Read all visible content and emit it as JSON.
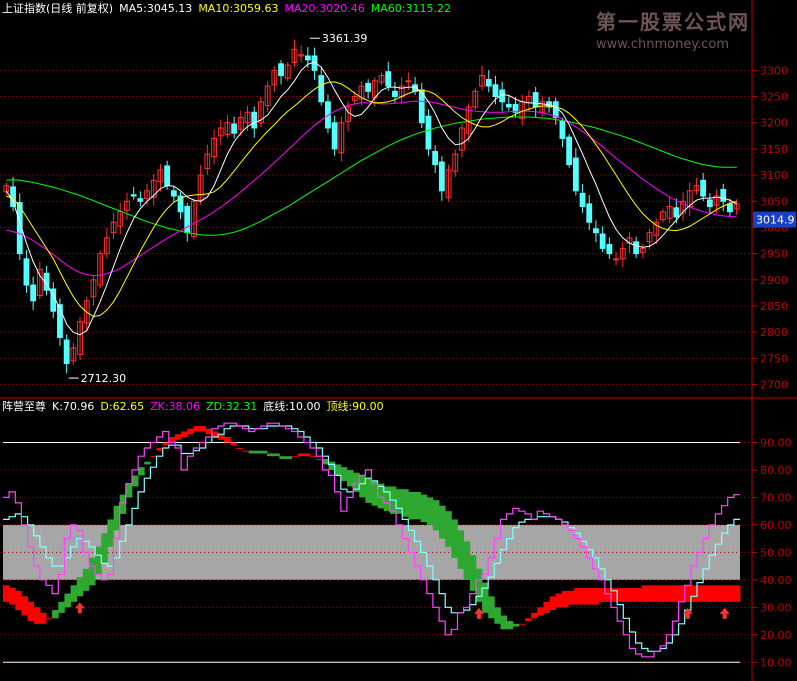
{
  "colors": {
    "background": "#000000",
    "up": "#ff3030",
    "down": "#54ffff",
    "ma5": "#ffffff",
    "ma10": "#ffff00",
    "ma20": "#ff00ff",
    "ma60": "#00ff00",
    "grid": "#8b0000",
    "axis": "#c00000",
    "axis_label": "#c00000",
    "indicator_red": "#ff0000",
    "indicator_green": "#2ea830",
    "band": "#a6a6a6",
    "k_line": "#ff44ff",
    "d_line": "#88ffff",
    "arrow": "#ff3030",
    "watermark": "#c79a9a"
  },
  "header": {
    "main_title": "上证指数(日线 前复权)",
    "ma5": "MA5:3045.13",
    "ma10": "MA10:3059.63",
    "ma20": "MA20:3020.46",
    "ma60": "MA60:3115.22"
  },
  "indicator_header": {
    "title": "阵营至尊",
    "k": "K:70.96",
    "d": "D:62.65",
    "zk": "ZK:38.06",
    "zd": "ZD:32.31",
    "bottom": "底线:10.00",
    "top": "顶线:90.00"
  },
  "watermark": {
    "line1": "第一股票公式网",
    "line2": "www.chnmoney.com"
  },
  "chart_data": [
    {
      "type": "candlestick",
      "title": "上证指数(日线 前复权)",
      "ylim": [
        2680,
        3400
      ],
      "y_ticks": [
        2700,
        2750,
        2800,
        2850,
        2900,
        2950,
        3000,
        3050,
        3100,
        3150,
        3200,
        3250,
        3300
      ],
      "last_price_label": "3014.9",
      "last_price": 3014.9,
      "annotations": [
        {
          "text": "3361.39",
          "value": 3361.39,
          "index": 45
        },
        {
          "text": "2712.30",
          "value": 2712.3,
          "index": 9
        }
      ],
      "closes": [
        3080,
        3040,
        2950,
        2890,
        2860,
        2920,
        2880,
        2840,
        2790,
        2740,
        2770,
        2820,
        2860,
        2900,
        2950,
        2980,
        3010,
        3030,
        3050,
        3060,
        3050,
        3070,
        3090,
        3110,
        3080,
        3060,
        3030,
        2990,
        3050,
        3100,
        3140,
        3170,
        3190,
        3200,
        3180,
        3210,
        3220,
        3190,
        3240,
        3270,
        3300,
        3290,
        3310,
        3340,
        3330,
        3320,
        3300,
        3240,
        3190,
        3150,
        3200,
        3230,
        3250,
        3270,
        3260,
        3280,
        3290,
        3270,
        3250,
        3270,
        3280,
        3260,
        3200,
        3150,
        3120,
        3070,
        3110,
        3140,
        3190,
        3230,
        3260,
        3290,
        3270,
        3250,
        3240,
        3230,
        3220,
        3240,
        3250,
        3230,
        3240,
        3230,
        3210,
        3170,
        3120,
        3070,
        3040,
        3010,
        2990,
        2960,
        2950,
        2940,
        2960,
        2980,
        2950,
        2960,
        2990,
        3010,
        3030,
        3040,
        3020,
        3050,
        3070,
        3080,
        3060,
        3040,
        3060,
        3050,
        3030,
        3045
      ],
      "ma5": [
        3070,
        3050,
        3010,
        2970,
        2935,
        2908,
        2892,
        2870,
        2845,
        2815,
        2800,
        2795,
        2803,
        2830,
        2858,
        2890,
        2925,
        2960,
        2990,
        3017,
        3036,
        3050,
        3061,
        3074,
        3080,
        3079,
        3070,
        3058,
        3052,
        3050,
        3058,
        3080,
        3110,
        3140,
        3164,
        3180,
        3193,
        3200,
        3205,
        3215,
        3232,
        3250,
        3263,
        3280,
        3300,
        3312,
        3316,
        3306,
        3286,
        3262,
        3240,
        3220,
        3212,
        3216,
        3230,
        3248,
        3262,
        3268,
        3268,
        3266,
        3268,
        3268,
        3258,
        3240,
        3218,
        3190,
        3170,
        3158,
        3160,
        3170,
        3190,
        3212,
        3230,
        3245,
        3254,
        3252,
        3245,
        3240,
        3238,
        3237,
        3236,
        3234,
        3230,
        3218,
        3196,
        3168,
        3140,
        3110,
        3082,
        3050,
        3020,
        2996,
        2980,
        2970,
        2965,
        2962,
        2964,
        2972,
        2985,
        3000,
        3014,
        3030,
        3042,
        3052,
        3056,
        3056,
        3058,
        3056,
        3052,
        3045
      ],
      "ma10": [
        3060,
        3055,
        3040,
        3020,
        3000,
        2980,
        2960,
        2940,
        2915,
        2890,
        2868,
        2850,
        2838,
        2830,
        2832,
        2842,
        2858,
        2880,
        2905,
        2930,
        2955,
        2978,
        3000,
        3020,
        3036,
        3048,
        3056,
        3060,
        3062,
        3063,
        3064,
        3068,
        3078,
        3092,
        3108,
        3124,
        3140,
        3156,
        3170,
        3184,
        3196,
        3210,
        3222,
        3232,
        3243,
        3254,
        3264,
        3272,
        3277,
        3278,
        3274,
        3266,
        3256,
        3248,
        3242,
        3238,
        3238,
        3240,
        3244,
        3250,
        3256,
        3260,
        3262,
        3260,
        3254,
        3244,
        3232,
        3220,
        3210,
        3202,
        3196,
        3192,
        3192,
        3196,
        3202,
        3210,
        3216,
        3222,
        3226,
        3230,
        3232,
        3232,
        3230,
        3226,
        3218,
        3206,
        3192,
        3176,
        3158,
        3140,
        3120,
        3100,
        3080,
        3060,
        3042,
        3026,
        3014,
        3004,
        2998,
        2995,
        2994,
        2997,
        3002,
        3010,
        3018,
        3026,
        3034,
        3041,
        3046,
        3050
      ],
      "ma20": [
        2995,
        2992,
        2988,
        2982,
        2975,
        2966,
        2958,
        2948,
        2938,
        2928,
        2920,
        2914,
        2910,
        2908,
        2909,
        2912,
        2916,
        2922,
        2930,
        2938,
        2946,
        2955,
        2963,
        2971,
        2979,
        2987,
        2994,
        3001,
        3008,
        3015,
        3022,
        3030,
        3039,
        3048,
        3058,
        3068,
        3079,
        3090,
        3101,
        3112,
        3124,
        3136,
        3148,
        3160,
        3172,
        3184,
        3195,
        3205,
        3214,
        3222,
        3228,
        3233,
        3236,
        3238,
        3238,
        3237,
        3236,
        3236,
        3237,
        3238,
        3240,
        3241,
        3241,
        3240,
        3238,
        3235,
        3232,
        3229,
        3226,
        3224,
        3222,
        3221,
        3220,
        3220,
        3220,
        3221,
        3222,
        3222,
        3222,
        3221,
        3219,
        3216,
        3212,
        3207,
        3200,
        3192,
        3183,
        3174,
        3164,
        3154,
        3143,
        3132,
        3122,
        3112,
        3102,
        3092,
        3083,
        3074,
        3066,
        3058,
        3051,
        3045,
        3039,
        3034,
        3030,
        3027,
        3024,
        3022,
        3021,
        3020
      ],
      "ma60": [
        3090,
        3091,
        3090,
        3088,
        3086,
        3083,
        3080,
        3077,
        3073,
        3069,
        3065,
        3061,
        3056,
        3051,
        3046,
        3041,
        3036,
        3031,
        3026,
        3021,
        3016,
        3011,
        3007,
        3003,
        2999,
        2996,
        2993,
        2990,
        2988,
        2986,
        2985,
        2985,
        2986,
        2988,
        2991,
        2995,
        3000,
        3006,
        3012,
        3019,
        3026,
        3033,
        3040,
        3048,
        3056,
        3064,
        3072,
        3080,
        3088,
        3096,
        3104,
        3112,
        3120,
        3128,
        3135,
        3142,
        3149,
        3156,
        3162,
        3168,
        3173,
        3178,
        3182,
        3186,
        3190,
        3193,
        3196,
        3199,
        3201,
        3203,
        3205,
        3207,
        3208,
        3209,
        3210,
        3211,
        3211,
        3211,
        3211,
        3210,
        3209,
        3208,
        3206,
        3204,
        3202,
        3199,
        3196,
        3193,
        3190,
        3186,
        3182,
        3178,
        3174,
        3170,
        3165,
        3160,
        3155,
        3150,
        3145,
        3140,
        3135,
        3131,
        3127,
        3123,
        3120,
        3118,
        3116,
        3115,
        3115,
        3115
      ]
    },
    {
      "type": "area",
      "title": "阵营至尊",
      "ylim": [
        5,
        100
      ],
      "y_ticks": [
        10,
        20,
        30,
        40,
        50,
        60,
        70,
        80,
        90
      ],
      "band": [
        40,
        60
      ],
      "hlines": [
        10,
        90
      ],
      "arrow_indices": [
        17,
        113,
        162,
        170
      ],
      "k": [
        70,
        72,
        68,
        60,
        52,
        45,
        40,
        38,
        35,
        42,
        55,
        60,
        58,
        50,
        45,
        42,
        40,
        42,
        55,
        68,
        75,
        80,
        85,
        88,
        90,
        92,
        94,
        90,
        88,
        80,
        85,
        88,
        90,
        92,
        95,
        96,
        97,
        97,
        96,
        95,
        94,
        95,
        96,
        97,
        97,
        96,
        95,
        94,
        92,
        90,
        88,
        85,
        80,
        78,
        72,
        65,
        70,
        75,
        78,
        80,
        75,
        70,
        68,
        65,
        60,
        55,
        50,
        45,
        40,
        35,
        30,
        25,
        20,
        22,
        28,
        30,
        35,
        40,
        42,
        48,
        55,
        62,
        64,
        66,
        65,
        64,
        62,
        65,
        64,
        63,
        62,
        60,
        58,
        55,
        52,
        48,
        44,
        40,
        35,
        30,
        25,
        20,
        15,
        13,
        12,
        12,
        14,
        16,
        20,
        25,
        32,
        38,
        45,
        50,
        55,
        60,
        64,
        67,
        70,
        71
      ],
      "d": [
        62,
        63,
        64,
        63,
        60,
        56,
        52,
        48,
        45,
        45,
        48,
        52,
        55,
        54,
        52,
        49,
        46,
        45,
        48,
        54,
        60,
        66,
        72,
        77,
        81,
        85,
        88,
        89,
        89,
        86,
        86,
        87,
        88,
        90,
        92,
        93,
        95,
        96,
        96,
        96,
        95,
        95,
        95,
        96,
        96,
        96,
        96,
        95,
        94,
        92,
        90,
        88,
        85,
        82,
        78,
        73,
        72,
        73,
        75,
        77,
        76,
        74,
        72,
        69,
        66,
        62,
        58,
        54,
        50,
        45,
        40,
        35,
        30,
        28,
        28,
        29,
        31,
        34,
        37,
        41,
        46,
        51,
        55,
        59,
        61,
        62,
        62,
        63,
        63,
        63,
        62,
        61,
        59,
        57,
        54,
        51,
        48,
        44,
        40,
        36,
        31,
        26,
        21,
        17,
        15,
        14,
        14,
        15,
        17,
        20,
        24,
        29,
        34,
        39,
        44,
        49,
        53,
        57,
        60,
        62
      ],
      "zk": [
        38,
        37,
        36,
        34,
        32,
        30,
        28,
        26,
        26,
        28,
        30,
        32,
        34,
        36,
        38,
        42,
        46,
        52,
        58,
        64,
        70,
        74,
        78,
        82,
        85,
        88,
        90,
        92,
        93,
        94,
        95,
        96,
        96,
        95,
        94,
        93,
        92,
        90,
        88,
        87,
        86,
        86,
        86,
        85,
        85,
        84,
        84,
        85,
        86,
        86,
        85,
        84,
        82,
        80,
        78,
        76,
        74,
        72,
        70,
        68,
        67,
        66,
        65,
        64,
        64,
        63,
        62,
        62,
        61,
        60,
        58,
        55,
        52,
        48,
        44,
        40,
        36,
        32,
        28,
        26,
        24,
        22,
        22,
        23,
        24,
        26,
        28,
        30,
        32,
        34,
        35,
        36,
        36,
        37,
        37,
        37,
        37,
        37,
        37,
        37,
        37,
        37,
        37,
        37,
        38,
        38,
        38,
        38,
        38,
        38,
        38,
        38,
        38,
        38,
        38,
        38,
        38,
        38,
        38,
        38
      ],
      "zd": [
        32,
        31,
        29,
        27,
        25,
        24,
        24,
        26,
        29,
        32,
        35,
        38,
        41,
        44,
        48,
        52,
        57,
        62,
        67,
        71,
        75,
        78,
        81,
        83,
        85,
        87,
        89,
        90,
        91,
        92,
        93,
        94,
        94,
        93,
        92,
        91,
        90,
        89,
        88,
        87,
        87,
        87,
        87,
        86,
        86,
        85,
        85,
        85,
        85,
        85,
        85,
        84,
        84,
        83,
        82,
        81,
        80,
        79,
        78,
        77,
        76,
        75,
        74,
        74,
        73,
        73,
        72,
        72,
        71,
        70,
        69,
        67,
        65,
        62,
        58,
        54,
        49,
        44,
        39,
        34,
        30,
        27,
        25,
        24,
        24,
        25,
        26,
        27,
        28,
        29,
        30,
        30,
        31,
        31,
        31,
        31,
        31,
        32,
        32,
        32,
        32,
        32,
        32,
        32,
        32,
        32,
        32,
        32,
        32,
        32,
        32,
        32,
        32,
        32,
        32,
        32,
        32,
        32,
        32,
        32
      ]
    }
  ]
}
